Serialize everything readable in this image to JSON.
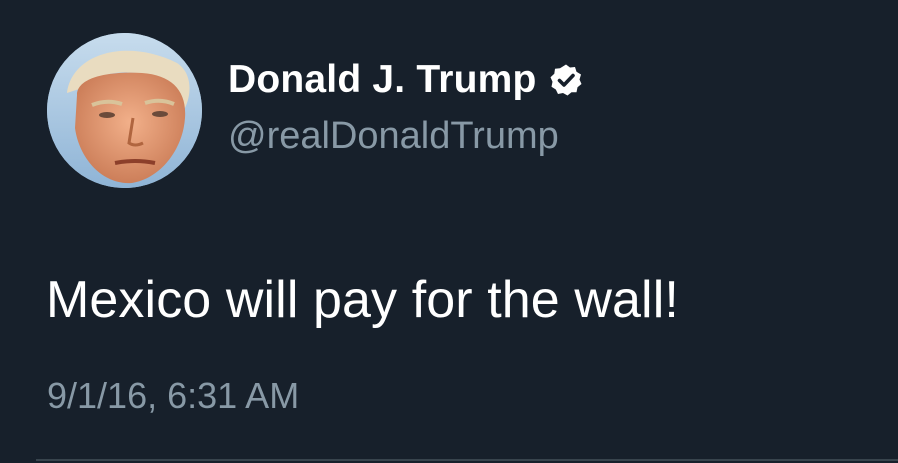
{
  "tweet": {
    "author": {
      "display_name": "Donald J. Trump",
      "handle": "@realDonaldTrump",
      "verified": true,
      "avatar_icon": "profile-photo"
    },
    "text": "Mexico will pay for the wall!",
    "timestamp": "9/1/16, 6:31 AM"
  },
  "colors": {
    "background": "#17202b",
    "primary_text": "#ffffff",
    "secondary_text": "#8899a6",
    "divider": "#38444d"
  }
}
